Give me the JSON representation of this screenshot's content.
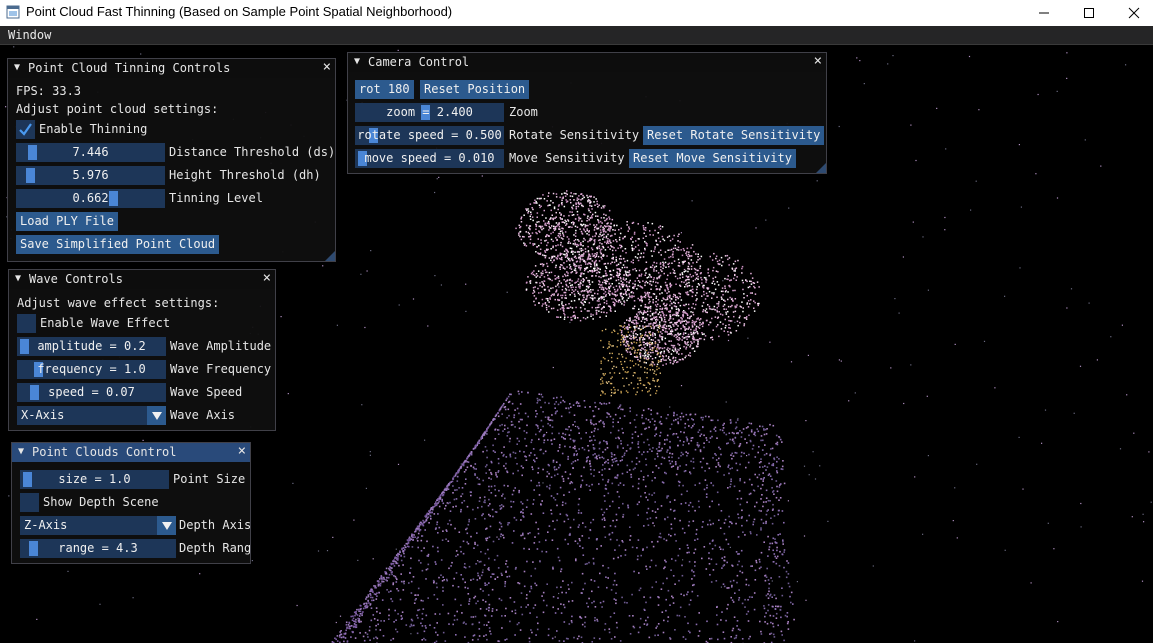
{
  "window": {
    "title": "Point Cloud Fast Thinning (Based on Sample Point Spatial Neighborhood)",
    "icons": [
      "app-icon",
      "minimize-icon",
      "maximize-icon",
      "close-icon"
    ]
  },
  "menubar": {
    "window_menu": "Window"
  },
  "close_glyph": "×",
  "tinning": {
    "title": "Point Cloud Tinning Controls",
    "fps": "FPS: 33.3",
    "adjust": "Adjust point cloud settings:",
    "enable_thinning": "Enable Thinning",
    "enable_thinning_checked": true,
    "ds_value": "7.446",
    "ds_label": "Distance Threshold (ds)",
    "dh_value": "5.976",
    "dh_label": "Height Threshold (dh)",
    "level_value": "0.662",
    "level_label": "Tinning Level",
    "load_button": "Load PLY File",
    "save_button": "Save Simplified Point Cloud"
  },
  "camera": {
    "title": "Camera Control",
    "rot_button": "rot 180",
    "reset_position": "Reset Position",
    "zoom_value": "zoom = 2.400",
    "zoom_label": "Zoom",
    "rotate_value": "rotate speed = 0.500",
    "rotate_label": "Rotate Sensitivity",
    "reset_rotate": "Reset Rotate Sensitivity",
    "move_value": "move speed = 0.010",
    "move_label": "Move Sensitivity",
    "reset_move": "Reset Move Sensitivity"
  },
  "wave": {
    "title": "Wave Controls",
    "adjust": "Adjust wave effect settings:",
    "enable_wave": "Enable Wave Effect",
    "enable_wave_checked": false,
    "amp_value": "amplitude = 0.2",
    "amp_label": "Wave Amplitude",
    "freq_value": "frequency = 1.0",
    "freq_label": "Wave Frequency",
    "speed_value": "speed = 0.07",
    "speed_label": "Wave Speed",
    "axis_value": "X-Axis",
    "axis_label": "Wave Axis"
  },
  "clouds": {
    "title": "Point Clouds Control",
    "size_value": "size = 1.0",
    "size_label": "Point Size",
    "depth_scene": "Show Depth Scene",
    "depth_scene_checked": false,
    "depth_axis_value": "Z-Axis",
    "depth_axis_label": "Depth Axis",
    "range_value": "range = 4.3",
    "range_label": "Depth Range"
  },
  "colors": {
    "window_bg": "#0f0f0f",
    "title_active": "#294a7a",
    "frame": "#1d3658",
    "button": "#2c5a8e",
    "grab": "#4a86d6",
    "tree_points": "#e3a6d8",
    "box_points": "#8e6fb5"
  }
}
